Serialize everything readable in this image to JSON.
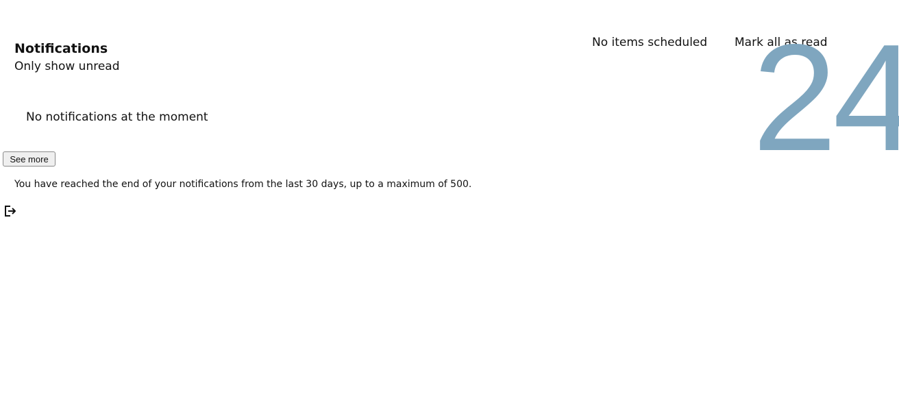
{
  "notifications": {
    "title": "Notifications",
    "unread_toggle_label": "Only show unread",
    "empty_message": "No notifications at the moment",
    "see_more_label": "See more",
    "end_message": "You have reached the end of your notifications from the last 30 days, up to a maximum of 500."
  },
  "header": {
    "scheduled_status": "No items scheduled",
    "mark_all_label": "Mark all as read"
  },
  "calendar": {
    "day_number": "24",
    "color": "#7fa6bf"
  },
  "icons": {
    "logout": "logout-icon"
  }
}
